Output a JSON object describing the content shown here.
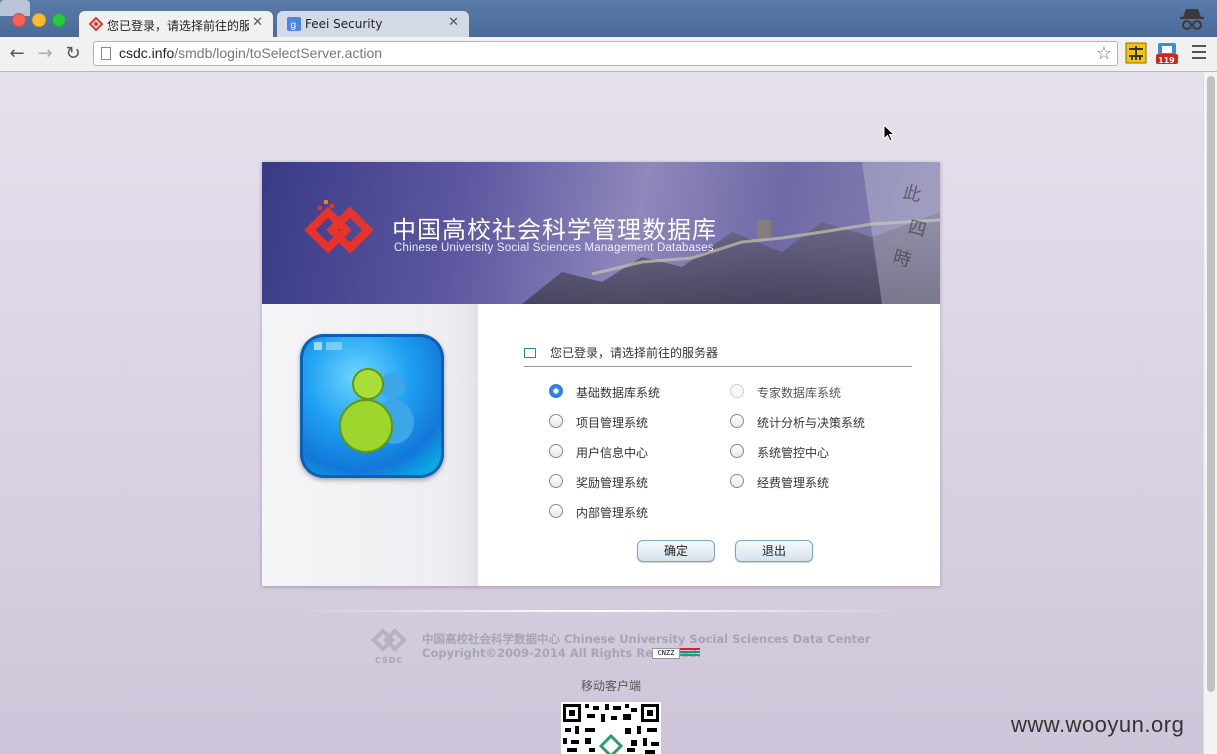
{
  "browser": {
    "tabs": [
      {
        "title": "您已登录，请选择前往的服务器",
        "active": true
      },
      {
        "title": "Feei Security",
        "active": false
      }
    ],
    "url_host": "csdc.info",
    "url_path": "/smdb/login/toSelectServer.action",
    "extension_badge": "119"
  },
  "banner": {
    "title": "中国高校社会科学管理数据库",
    "subtitle": "Chinese University Social Sciences Management Databases"
  },
  "server_select": {
    "heading": "您已登录，请选择前往的服务器",
    "options_left": [
      {
        "label": "基础数据库系统",
        "state": "checked"
      },
      {
        "label": "项目管理系统",
        "state": "unchecked"
      },
      {
        "label": "用户信息中心",
        "state": "unchecked"
      },
      {
        "label": "奖励管理系统",
        "state": "unchecked"
      },
      {
        "label": "内部管理系统",
        "state": "unchecked"
      }
    ],
    "options_right": [
      {
        "label": "专家数据库系统",
        "state": "disabled"
      },
      {
        "label": "统计分析与决策系统",
        "state": "unchecked"
      },
      {
        "label": "系统管控中心",
        "state": "unchecked"
      },
      {
        "label": "经费管理系统",
        "state": "unchecked"
      }
    ],
    "confirm_label": "确定",
    "exit_label": "退出"
  },
  "footer": {
    "org": "中国高校社会科学数据中心 Chinese University Social Sciences Data Center",
    "copyright": "Copyright©2009-2014 All Rights Reserved.",
    "cnzz": "CNZZ",
    "logo_text": "CSDC",
    "mobile_client": "移动客户端"
  },
  "watermark": "www.wooyun.org",
  "colors": {
    "accent": "#3c8ff0",
    "banner": "#5d58a0",
    "page_bg": "#e2dbe8",
    "titlebar": "#5a7ba8"
  }
}
